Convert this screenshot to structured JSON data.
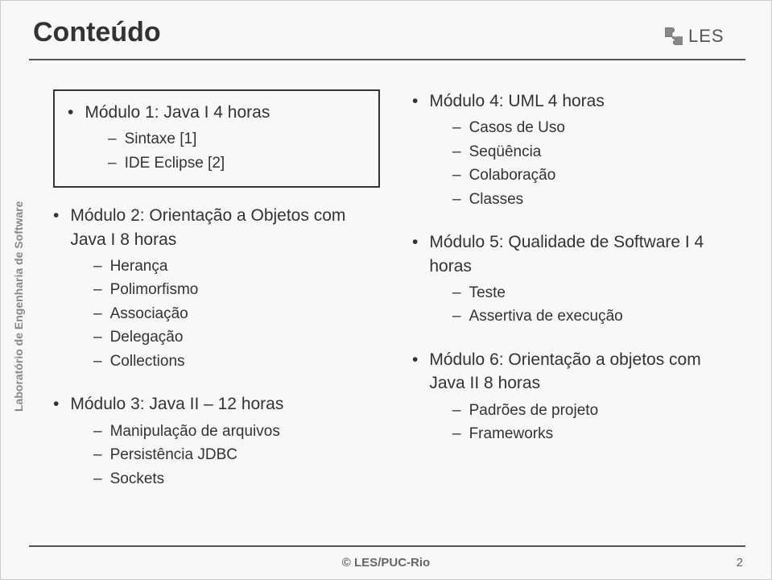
{
  "title": "Conteúdo",
  "logo_text": "LES",
  "sidebar": "Laboratório de Engenharia de Software",
  "left": {
    "mod1": {
      "title": "Módulo 1: Java I 4 horas",
      "items": [
        "Sintaxe [1]",
        "IDE Eclipse [2]"
      ]
    },
    "mod2": {
      "title": "Módulo 2: Orientação a Objetos com Java I 8 horas",
      "items": [
        "Herança",
        "Polimorfismo",
        "Associação",
        "Delegação",
        "Collections"
      ]
    },
    "mod3": {
      "title": "Módulo 3: Java II – 12 horas",
      "items": [
        "Manipulação de arquivos",
        "Persistência JDBC",
        "Sockets"
      ]
    }
  },
  "right": {
    "mod4": {
      "title": "Módulo 4: UML 4 horas",
      "items": [
        "Casos de Uso",
        "Seqüência",
        "Colaboração",
        "Classes"
      ]
    },
    "mod5": {
      "title": "Módulo 5: Qualidade de Software I 4 horas",
      "items": [
        "Teste",
        "Assertiva de execução"
      ]
    },
    "mod6": {
      "title": "Módulo 6: Orientação a objetos com Java II 8 horas",
      "items": [
        "Padrões de projeto",
        "Frameworks"
      ]
    }
  },
  "footer": {
    "center": "© LES/PUC-Rio",
    "page": "2"
  }
}
